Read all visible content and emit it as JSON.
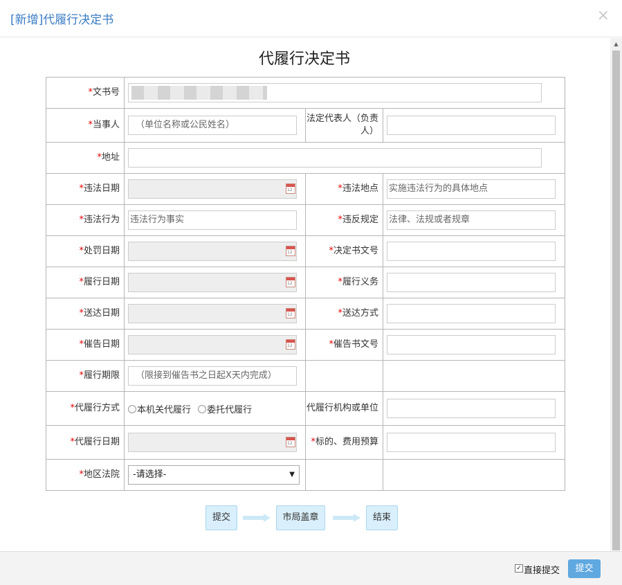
{
  "dialog": {
    "title": "[新增]代履行决定书",
    "close_glyph": "×"
  },
  "doc_title": "代履行决定书",
  "required_mark": "*",
  "fields": {
    "doc_number": {
      "label": "文书号",
      "value": ""
    },
    "party": {
      "label": "当事人",
      "placeholder": "（单位名称或公民姓名）"
    },
    "legal_rep": {
      "label": "法定代表人（负责人）",
      "value": ""
    },
    "address": {
      "label": "地址",
      "value": ""
    },
    "violation_date": {
      "label": "违法日期",
      "value": ""
    },
    "violation_place": {
      "label": "违法地点",
      "placeholder": "实施违法行为的具体地点"
    },
    "violation_act": {
      "label": "违法行为",
      "placeholder": "违法行为事实"
    },
    "violated_rule": {
      "label": "违反规定",
      "placeholder": "法律、法规或者规章"
    },
    "penalty_date": {
      "label": "处罚日期",
      "value": ""
    },
    "decision_number": {
      "label": "决定书文号",
      "value": ""
    },
    "perform_date": {
      "label": "履行日期",
      "value": ""
    },
    "perform_duty": {
      "label": "履行义务",
      "value": ""
    },
    "delivery_date": {
      "label": "送达日期",
      "value": ""
    },
    "delivery_method": {
      "label": "送达方式",
      "value": ""
    },
    "urge_date": {
      "label": "催告日期",
      "value": ""
    },
    "urge_number": {
      "label": "催告书文号",
      "value": ""
    },
    "perform_deadline": {
      "label": "履行期限",
      "placeholder": "（限接到催告书之日起X天内完成）"
    },
    "substitute_method": {
      "label": "代履行方式",
      "options": [
        "本机关代履行",
        "委托代履行"
      ]
    },
    "substitute_org": {
      "label": "代履行机构或单位",
      "value": ""
    },
    "substitute_date": {
      "label": "代履行日期",
      "value": ""
    },
    "budget": {
      "label": "标的、费用预算",
      "value": ""
    },
    "court": {
      "label": "地区法院",
      "selected": "-请选择-"
    }
  },
  "calendar_icon_text": "12",
  "flow": [
    "提交",
    "市局盖章",
    "结束"
  ],
  "footer": {
    "direct_submit_label": "直接提交",
    "direct_submit_checked": true,
    "submit_label": "提交"
  },
  "colors": {
    "title_blue": "#3a7cc4",
    "required_red": "#e60000",
    "submit_button": "#5fa8e0",
    "flow_step_bg": "#d9effb"
  }
}
